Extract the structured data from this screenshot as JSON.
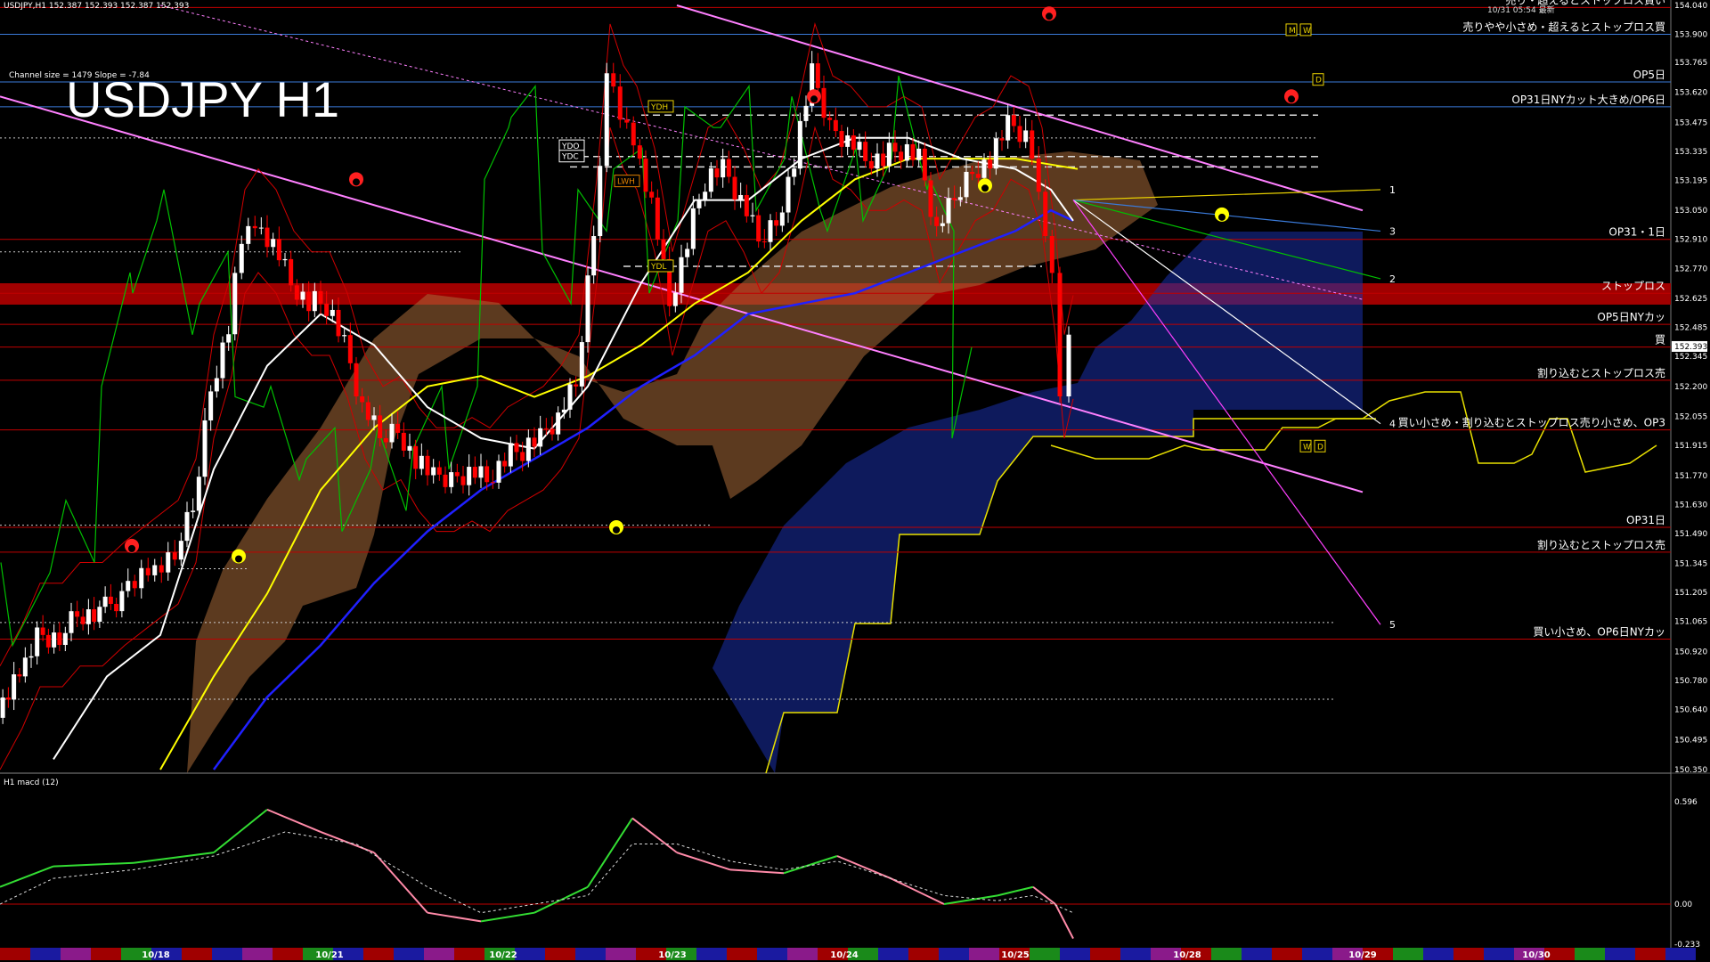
{
  "window": {
    "symbol_header": "USDJPY,H1",
    "ohlc": [
      "152.387",
      "152.393",
      "152.387",
      "152.393"
    ],
    "server_time": "10/31 05:54 最新",
    "watermark_title": "USDJPY H1",
    "channel_info": "Channel size = 1479 Slope = -7.84"
  },
  "colors": {
    "background": "#000000",
    "candle_up": "#ffffff",
    "candle_down": "#ff0000",
    "ma_white": "#ffffff",
    "ma_yellow": "#ffff00",
    "ma_blue": "#2020ff",
    "bollinger": "#d00000",
    "chikou": "#00c000",
    "channel": "#ff80ff",
    "level_line": "#c00000",
    "level_blue": "#3a7ad9",
    "kumo_blue": "#2040c0",
    "kumo_brown": "#c07a40",
    "macd_bull": "#33dd33",
    "macd_bear": "#ff8aa8",
    "stop_zone": "#a00000"
  },
  "chart_data": {
    "type": "candlestick",
    "symbol": "USDJPY",
    "timeframe": "H1",
    "price_axis": {
      "ylim": [
        150.35,
        154.04
      ],
      "ticks": [
        "154.040",
        "153.900",
        "153.765",
        "153.620",
        "153.475",
        "153.335",
        "153.195",
        "153.050",
        "152.910",
        "152.770",
        "152.625",
        "152.485",
        "152.345",
        "152.200",
        "152.055",
        "151.915",
        "151.770",
        "151.630",
        "151.490",
        "151.345",
        "151.205",
        "151.065",
        "150.920",
        "150.780",
        "150.640",
        "150.495",
        "150.350"
      ],
      "current_price": "152.393"
    },
    "date_axis": [
      "10/18",
      "10/21",
      "10/22",
      "10/23",
      "10/24",
      "10/25",
      "10/28",
      "10/29",
      "10/30"
    ],
    "levels": [
      {
        "label": "売り・超えるとストップロス買い",
        "price": 154.03
      },
      {
        "label": "売りやや小さめ・超えるとストップロス買",
        "price": 153.9
      },
      {
        "label": "OP5日",
        "price": 153.67
      },
      {
        "label": "OP31日NYカット大きめ/OP6日",
        "price": 153.55
      },
      {
        "label": "OP31・1日",
        "price": 152.91
      },
      {
        "label": "ストップロス",
        "price": 152.65
      },
      {
        "label": "OP5日NYカッ",
        "price": 152.5
      },
      {
        "label": "買",
        "price": 152.39
      },
      {
        "label": "割り込むとストップロス売",
        "price": 152.23
      },
      {
        "label": "買い小さめ・割り込むとストップロス売り小さめ、OP3",
        "price": 151.99
      },
      {
        "label": "OP31日",
        "price": 151.52
      },
      {
        "label": "割り込むとストップロス売",
        "price": 151.4
      },
      {
        "label": "買い小さめ、OP6日NYカッ",
        "price": 150.98
      }
    ],
    "wave_labels": [
      "1",
      "2",
      "3",
      "4",
      "5"
    ],
    "tags": [
      "YDH",
      "YDO",
      "YDC",
      "LWH",
      "YDL",
      "M",
      "W",
      "D",
      "W",
      "D"
    ],
    "close_path": [
      [
        0,
        150.6
      ],
      [
        25,
        150.8
      ],
      [
        45,
        151.0
      ],
      [
        70,
        151.0
      ],
      [
        90,
        151.1
      ],
      [
        115,
        151.1
      ],
      [
        140,
        151.2
      ],
      [
        170,
        151.3
      ],
      [
        200,
        151.4
      ],
      [
        220,
        151.6
      ],
      [
        240,
        152.2
      ],
      [
        260,
        152.5
      ],
      [
        275,
        152.9
      ],
      [
        290,
        153.0
      ],
      [
        310,
        152.9
      ],
      [
        330,
        152.7
      ],
      [
        350,
        152.6
      ],
      [
        370,
        152.6
      ],
      [
        390,
        152.4
      ],
      [
        410,
        152.1
      ],
      [
        430,
        151.95
      ],
      [
        450,
        152.0
      ],
      [
        470,
        151.85
      ],
      [
        490,
        151.75
      ],
      [
        510,
        151.75
      ],
      [
        530,
        151.8
      ],
      [
        550,
        151.75
      ],
      [
        570,
        151.85
      ],
      [
        590,
        151.9
      ],
      [
        610,
        151.95
      ],
      [
        630,
        152.05
      ],
      [
        650,
        152.2
      ],
      [
        670,
        152.95
      ],
      [
        685,
        153.7
      ],
      [
        700,
        153.5
      ],
      [
        715,
        153.4
      ],
      [
        735,
        153.1
      ],
      [
        755,
        152.6
      ],
      [
        775,
        152.9
      ],
      [
        795,
        153.2
      ],
      [
        815,
        153.25
      ],
      [
        835,
        153.1
      ],
      [
        855,
        152.9
      ],
      [
        875,
        153.0
      ],
      [
        895,
        153.3
      ],
      [
        915,
        153.7
      ],
      [
        935,
        153.45
      ],
      [
        955,
        153.4
      ],
      [
        975,
        153.3
      ],
      [
        995,
        153.3
      ],
      [
        1015,
        153.35
      ],
      [
        1035,
        153.3
      ],
      [
        1055,
        152.95
      ],
      [
        1075,
        153.1
      ],
      [
        1095,
        153.25
      ],
      [
        1115,
        153.3
      ],
      [
        1135,
        153.45
      ],
      [
        1155,
        153.4
      ],
      [
        1170,
        153.2
      ],
      [
        1185,
        152.7
      ],
      [
        1195,
        152.2
      ],
      [
        1205,
        152.39
      ]
    ],
    "ma_white": [
      [
        60,
        150.4
      ],
      [
        120,
        150.8
      ],
      [
        180,
        151.0
      ],
      [
        240,
        151.8
      ],
      [
        300,
        152.3
      ],
      [
        360,
        152.55
      ],
      [
        420,
        152.4
      ],
      [
        480,
        152.1
      ],
      [
        540,
        151.95
      ],
      [
        600,
        151.9
      ],
      [
        660,
        152.2
      ],
      [
        720,
        152.7
      ],
      [
        780,
        153.1
      ],
      [
        840,
        153.1
      ],
      [
        900,
        153.3
      ],
      [
        960,
        153.4
      ],
      [
        1020,
        153.4
      ],
      [
        1080,
        153.3
      ],
      [
        1140,
        153.25
      ],
      [
        1180,
        153.15
      ],
      [
        1205,
        153.0
      ]
    ],
    "ma_yellow": [
      [
        180,
        150.35
      ],
      [
        240,
        150.8
      ],
      [
        300,
        151.2
      ],
      [
        360,
        151.7
      ],
      [
        420,
        152.0
      ],
      [
        480,
        152.2
      ],
      [
        540,
        152.25
      ],
      [
        600,
        152.15
      ],
      [
        660,
        152.25
      ],
      [
        720,
        152.4
      ],
      [
        780,
        152.6
      ],
      [
        840,
        152.75
      ],
      [
        900,
        153.0
      ],
      [
        960,
        153.2
      ],
      [
        1020,
        153.3
      ],
      [
        1080,
        153.3
      ],
      [
        1140,
        153.3
      ],
      [
        1210,
        153.25
      ]
    ],
    "ma_blue": [
      [
        240,
        150.35
      ],
      [
        300,
        150.7
      ],
      [
        360,
        150.95
      ],
      [
        420,
        151.25
      ],
      [
        480,
        151.5
      ],
      [
        540,
        151.7
      ],
      [
        600,
        151.85
      ],
      [
        660,
        152.0
      ],
      [
        720,
        152.2
      ],
      [
        780,
        152.35
      ],
      [
        840,
        152.55
      ],
      [
        900,
        152.6
      ],
      [
        960,
        152.65
      ],
      [
        1020,
        152.75
      ],
      [
        1080,
        152.85
      ],
      [
        1140,
        152.95
      ],
      [
        1180,
        153.05
      ],
      [
        1205,
        153.0
      ]
    ],
    "channel_lines": [
      [
        [
          0,
          153.6
        ],
        [
          1530,
          151.69
        ]
      ],
      [
        [
          760,
          154.04
        ],
        [
          1530,
          153.05
        ]
      ]
    ],
    "macd": {
      "ylim": [
        -0.233,
        0.596
      ],
      "ticks": [
        "0.596",
        "0.00",
        "-0.233"
      ],
      "label": "H1  macd (12)",
      "main": [
        [
          0,
          0.1
        ],
        [
          60,
          0.22
        ],
        [
          150,
          0.24
        ],
        [
          240,
          0.3
        ],
        [
          300,
          0.55
        ],
        [
          360,
          0.42
        ],
        [
          420,
          0.3
        ],
        [
          480,
          -0.05
        ],
        [
          540,
          -0.1
        ],
        [
          600,
          -0.05
        ],
        [
          660,
          0.1
        ],
        [
          710,
          0.5
        ],
        [
          760,
          0.3
        ],
        [
          820,
          0.2
        ],
        [
          880,
          0.18
        ],
        [
          940,
          0.28
        ],
        [
          1000,
          0.15
        ],
        [
          1060,
          0.0
        ],
        [
          1120,
          0.05
        ],
        [
          1160,
          0.1
        ],
        [
          1185,
          0.0
        ],
        [
          1205,
          -0.2
        ]
      ],
      "signal": [
        [
          0,
          0.0
        ],
        [
          60,
          0.15
        ],
        [
          150,
          0.2
        ],
        [
          240,
          0.28
        ],
        [
          320,
          0.42
        ],
        [
          400,
          0.35
        ],
        [
          480,
          0.1
        ],
        [
          540,
          -0.05
        ],
        [
          600,
          0.0
        ],
        [
          660,
          0.05
        ],
        [
          710,
          0.35
        ],
        [
          760,
          0.35
        ],
        [
          820,
          0.25
        ],
        [
          880,
          0.2
        ],
        [
          940,
          0.25
        ],
        [
          1000,
          0.15
        ],
        [
          1060,
          0.05
        ],
        [
          1120,
          0.02
        ],
        [
          1160,
          0.05
        ],
        [
          1205,
          -0.05
        ]
      ]
    }
  }
}
